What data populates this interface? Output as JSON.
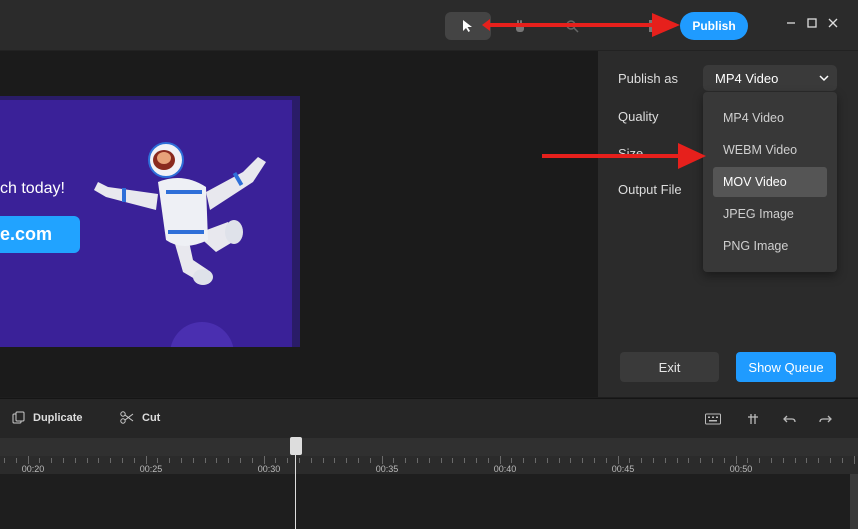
{
  "topbar": {
    "tools": [
      {
        "name": "select-tool",
        "icon": "pointer-icon"
      },
      {
        "name": "hand-tool",
        "icon": "hand-icon"
      },
      {
        "name": "zoom-tool",
        "icon": "magnifier-icon"
      },
      {
        "name": "undo-partial",
        "icon": "partial-icon"
      }
    ],
    "publish_label": "Publish",
    "window_controls": [
      "minimize-icon",
      "maximize-icon",
      "close-icon"
    ]
  },
  "slide": {
    "headline_fragment": "ch today!",
    "button_fragment": "e.com"
  },
  "publish_panel": {
    "publish_as_label": "Publish as",
    "publish_as_value": "MP4 Video",
    "quality_label": "Quality",
    "size_label": "Size",
    "output_label": "Output File",
    "options": [
      "MP4 Video",
      "WEBM Video",
      "MOV Video",
      "JPEG Image",
      "PNG Image"
    ],
    "highlighted_option": "MOV Video",
    "exit_label": "Exit",
    "queue_label": "Show Queue"
  },
  "timeline": {
    "duplicate_label": "Duplicate",
    "cut_label": "Cut",
    "ticks": [
      "00:20",
      "00:25",
      "00:30",
      "00:35",
      "00:40",
      "00:45",
      "00:50"
    ]
  },
  "colors": {
    "accent": "#1f9bff",
    "annotation_arrow": "#e6201c",
    "slide_bg": "#3a2198"
  }
}
